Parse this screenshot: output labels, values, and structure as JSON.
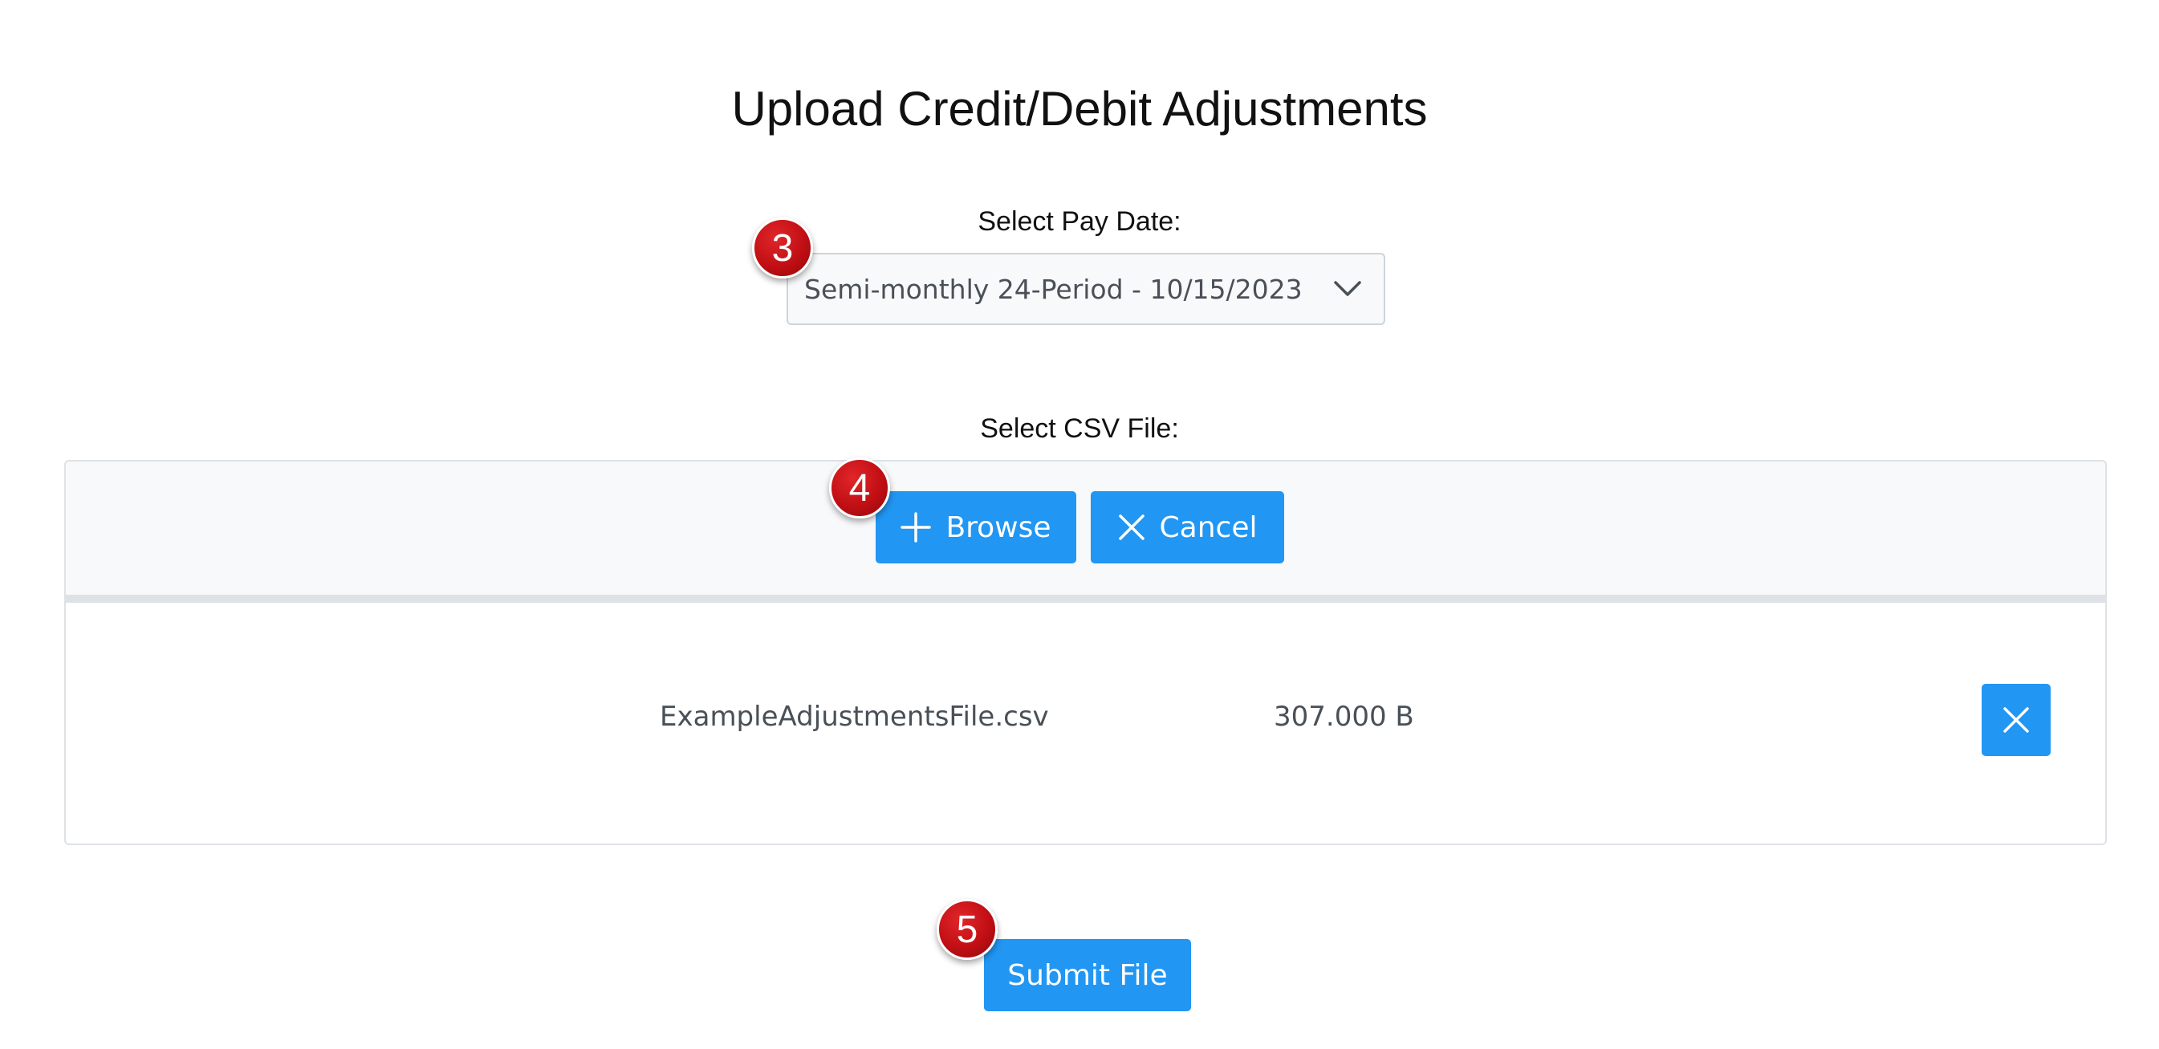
{
  "page": {
    "title": "Upload Credit/Debit Adjustments"
  },
  "pay_date": {
    "label": "Select Pay Date:",
    "selected_value": "Semi-monthly 24-Period - 10/15/2023",
    "chevron_icon": "chevron-down-icon"
  },
  "csv_file": {
    "label": "Select CSV File:",
    "browse_label": "Browse",
    "browse_icon": "plus-icon",
    "cancel_label": "Cancel",
    "cancel_icon": "close-icon",
    "files": [
      {
        "name": "ExampleAdjustmentsFile.csv",
        "size": "307.000 B",
        "remove_icon": "close-icon"
      }
    ]
  },
  "submit": {
    "label": "Submit File"
  },
  "steps": {
    "pay_date_step": "3",
    "browse_step": "4",
    "submit_step": "5"
  },
  "colors": {
    "primary_button": "#2196f3",
    "step_badge": "#c10f14",
    "panel_header": "#f8f9fa",
    "border": "#dee2e6",
    "text_muted": "#495057"
  }
}
